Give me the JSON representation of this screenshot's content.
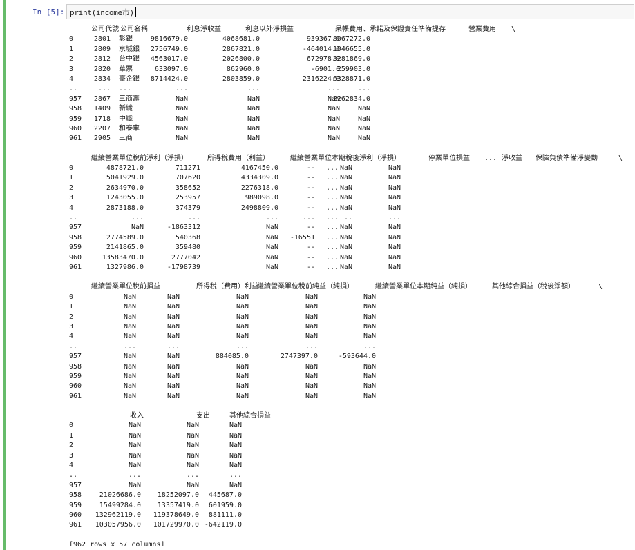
{
  "cell": {
    "prompt": "In [5]:",
    "code": "print(income市)"
  },
  "blocks": [
    {
      "id": "b1",
      "headers": [
        "公司代號",
        "公司名稱",
        "利息淨收益",
        "利息以外淨損益",
        "呆帳費用、承諾及保證責任準備提存",
        "營業費用",
        "\\"
      ],
      "rows": [
        [
          "0",
          "2801",
          "彰銀",
          "9816679.0",
          "4068681.0",
          "939367.0",
          "8067272.0"
        ],
        [
          "1",
          "2809",
          "京城銀",
          "2756749.0",
          "2867821.0",
          "-464014.0",
          "1046655.0"
        ],
        [
          "2",
          "2812",
          "台中銀",
          "4563017.0",
          "2026800.0",
          "672978.0",
          "3281869.0"
        ],
        [
          "3",
          "2820",
          "華票",
          "633097.0",
          "862960.0",
          "-6901.0",
          "259903.0"
        ],
        [
          "4",
          "2834",
          "臺企銀",
          "8714424.0",
          "2803859.0",
          "2316224.0",
          "6328871.0"
        ],
        [
          "..",
          "...",
          "...",
          "...",
          "...",
          "...",
          "..."
        ],
        [
          "957",
          "2867",
          "三商壽",
          "NaN",
          "NaN",
          "NaN",
          "2262834.0"
        ],
        [
          "958",
          "1409",
          "新纖",
          "NaN",
          "NaN",
          "NaN",
          "NaN"
        ],
        [
          "959",
          "1718",
          "中纖",
          "NaN",
          "NaN",
          "NaN",
          "NaN"
        ],
        [
          "960",
          "2207",
          "和泰車",
          "NaN",
          "NaN",
          "NaN",
          "NaN"
        ],
        [
          "961",
          "2905",
          "三商",
          "NaN",
          "NaN",
          "NaN",
          "NaN"
        ]
      ]
    },
    {
      "id": "b2",
      "headers": [
        "繼續營業單位稅前淨利（淨損）",
        "所得稅費用（利益）",
        "繼續營業單位本期稅後淨利（淨損）",
        "停業單位損益",
        "...",
        "淨收益",
        "保險負債準備淨變動",
        "\\"
      ],
      "rows": [
        [
          "0",
          "4878721.0",
          "711271",
          "4167450.0",
          "--",
          "...",
          "NaN",
          "NaN"
        ],
        [
          "1",
          "5041929.0",
          "707620",
          "4334309.0",
          "--",
          "...",
          "NaN",
          "NaN"
        ],
        [
          "2",
          "2634970.0",
          "358652",
          "2276318.0",
          "--",
          "...",
          "NaN",
          "NaN"
        ],
        [
          "3",
          "1243055.0",
          "253957",
          "989098.0",
          "--",
          "...",
          "NaN",
          "NaN"
        ],
        [
          "4",
          "2873188.0",
          "374379",
          "2498809.0",
          "--",
          "...",
          "NaN",
          "NaN"
        ],
        [
          "..",
          "...",
          "...",
          "...",
          "...",
          "...",
          "..",
          "..."
        ],
        [
          "957",
          "NaN",
          "-1863312",
          "NaN",
          "--",
          "...",
          "NaN",
          "NaN"
        ],
        [
          "958",
          "2774589.0",
          "540368",
          "NaN",
          "-16551",
          "...",
          "NaN",
          "NaN"
        ],
        [
          "959",
          "2141865.0",
          "359480",
          "NaN",
          "--",
          "...",
          "NaN",
          "NaN"
        ],
        [
          "960",
          "13583470.0",
          "2777042",
          "NaN",
          "--",
          "...",
          "NaN",
          "NaN"
        ],
        [
          "961",
          "1327986.0",
          "-1798739",
          "NaN",
          "--",
          "...",
          "NaN",
          "NaN"
        ]
      ]
    },
    {
      "id": "b3",
      "headers": [
        "繼續營業單位稅前損益",
        "所得稅（費用）利益",
        "繼續營業單位稅前純益（純損）",
        "繼續營業單位本期純益（純損）",
        "其他綜合損益（稅後淨額）",
        "\\"
      ],
      "rows": [
        [
          "0",
          "NaN",
          "NaN",
          "NaN",
          "NaN",
          "NaN"
        ],
        [
          "1",
          "NaN",
          "NaN",
          "NaN",
          "NaN",
          "NaN"
        ],
        [
          "2",
          "NaN",
          "NaN",
          "NaN",
          "NaN",
          "NaN"
        ],
        [
          "3",
          "NaN",
          "NaN",
          "NaN",
          "NaN",
          "NaN"
        ],
        [
          "4",
          "NaN",
          "NaN",
          "NaN",
          "NaN",
          "NaN"
        ],
        [
          "..",
          "...",
          "...",
          "...",
          "...",
          "..."
        ],
        [
          "957",
          "NaN",
          "NaN",
          "884085.0",
          "2747397.0",
          "-593644.0"
        ],
        [
          "958",
          "NaN",
          "NaN",
          "NaN",
          "NaN",
          "NaN"
        ],
        [
          "959",
          "NaN",
          "NaN",
          "NaN",
          "NaN",
          "NaN"
        ],
        [
          "960",
          "NaN",
          "NaN",
          "NaN",
          "NaN",
          "NaN"
        ],
        [
          "961",
          "NaN",
          "NaN",
          "NaN",
          "NaN",
          "NaN"
        ]
      ]
    },
    {
      "id": "b4",
      "headers": [
        "收入",
        "支出",
        "其他綜合損益"
      ],
      "rows": [
        [
          "0",
          "NaN",
          "NaN",
          "NaN"
        ],
        [
          "1",
          "NaN",
          "NaN",
          "NaN"
        ],
        [
          "2",
          "NaN",
          "NaN",
          "NaN"
        ],
        [
          "3",
          "NaN",
          "NaN",
          "NaN"
        ],
        [
          "4",
          "NaN",
          "NaN",
          "NaN"
        ],
        [
          "..",
          "...",
          "...",
          "..."
        ],
        [
          "957",
          "NaN",
          "NaN",
          "NaN"
        ],
        [
          "958",
          "21026686.0",
          "18252097.0",
          "445687.0"
        ],
        [
          "959",
          "15499284.0",
          "13357419.0",
          "601959.0"
        ],
        [
          "960",
          "132962119.0",
          "119378649.0",
          "881111.0"
        ],
        [
          "961",
          "103057956.0",
          "101729970.0",
          "-642119.0"
        ]
      ]
    }
  ],
  "summary": "[962 rows x 57 columns]"
}
